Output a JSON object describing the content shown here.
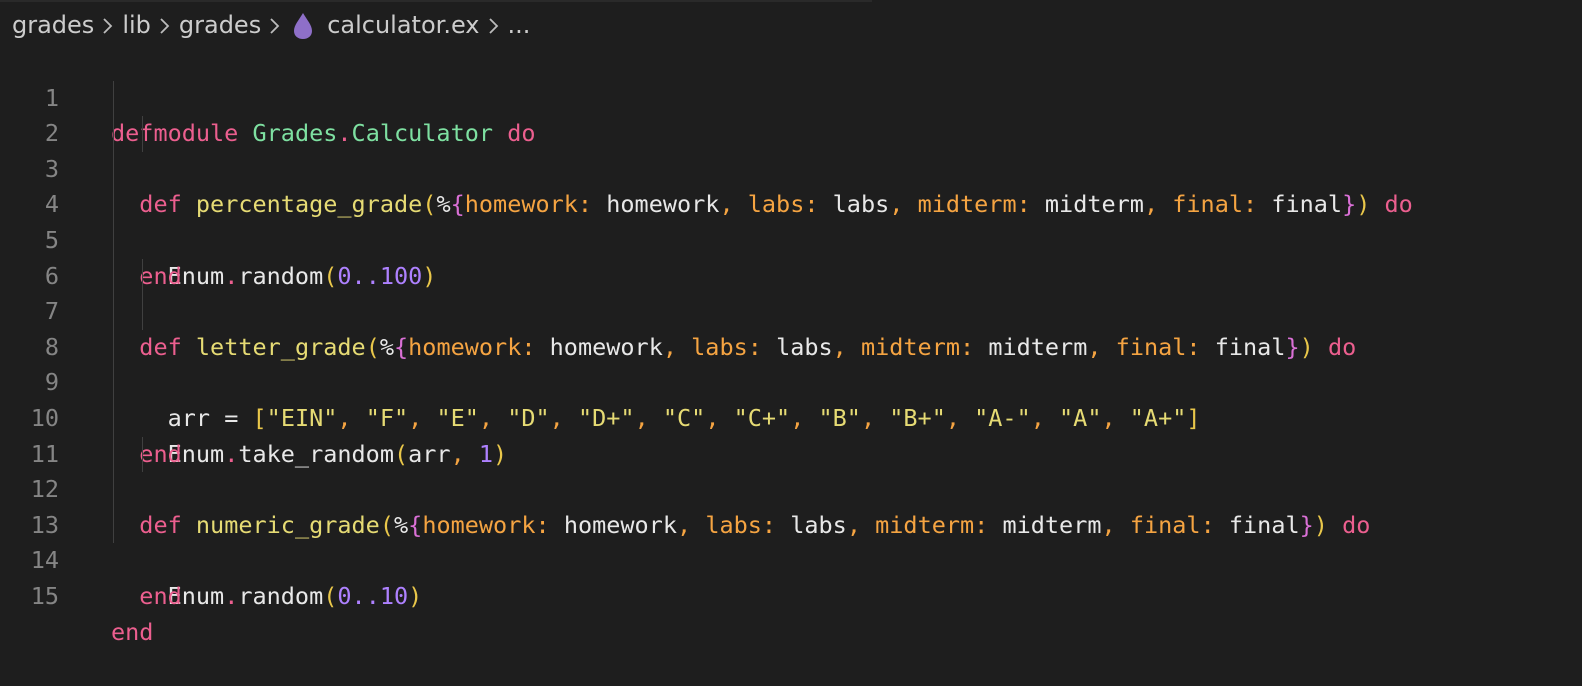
{
  "breadcrumb": {
    "items": [
      "grades",
      "lib",
      "grades",
      "calculator.ex",
      "..."
    ],
    "file_icon": "elixir-drop-icon",
    "file_icon_color": "#8e6fc8"
  },
  "editor": {
    "lines": [
      {
        "n": "1"
      },
      {
        "n": "2"
      },
      {
        "n": "3"
      },
      {
        "n": "4"
      },
      {
        "n": "5"
      },
      {
        "n": "6"
      },
      {
        "n": "7"
      },
      {
        "n": "8"
      },
      {
        "n": "9"
      },
      {
        "n": "10"
      },
      {
        "n": "11"
      },
      {
        "n": "12"
      },
      {
        "n": "13"
      },
      {
        "n": "14"
      },
      {
        "n": "15"
      }
    ],
    "code": {
      "l1": [
        "defmodule",
        " ",
        "Grades",
        ".",
        "Calculator",
        " ",
        "do"
      ],
      "l2": [
        "def",
        " ",
        "percentage_grade",
        "(",
        "%",
        "{",
        "homework:",
        " ",
        "homework",
        ",",
        " ",
        "labs:",
        " ",
        "labs",
        ",",
        " ",
        "midterm:",
        " ",
        "midterm",
        ",",
        " ",
        "final:",
        " ",
        "final",
        "}",
        ")",
        " ",
        "do"
      ],
      "l3": [
        "Enum",
        ".",
        "random",
        "(",
        "0",
        "..",
        "100",
        ")"
      ],
      "l4": [
        "end"
      ],
      "l6": [
        "def",
        " ",
        "letter_grade",
        "(",
        "%",
        "{",
        "homework:",
        " ",
        "homework",
        ",",
        " ",
        "labs:",
        " ",
        "labs",
        ",",
        " ",
        "midterm:",
        " ",
        "midterm",
        ",",
        " ",
        "final:",
        " ",
        "final",
        "}",
        ")",
        " ",
        "do"
      ],
      "l7": [
        "arr",
        " ",
        "=",
        " ",
        "[",
        "\"EIN\"",
        ", ",
        "\"F\"",
        ", ",
        "\"E\"",
        ", ",
        "\"D\"",
        ", ",
        "\"D+\"",
        ", ",
        "\"C\"",
        ", ",
        "\"C+\"",
        ", ",
        "\"B\"",
        ", ",
        "\"B+\"",
        ", ",
        "\"A-\"",
        ", ",
        "\"A\"",
        ", ",
        "\"A+\"",
        "]"
      ],
      "l8": [
        "Enum",
        ".",
        "take_random",
        "(",
        "arr",
        ", ",
        "1",
        ")"
      ],
      "l9": [
        "end"
      ],
      "l11": [
        "def",
        " ",
        "numeric_grade",
        "(",
        "%",
        "{",
        "homework:",
        " ",
        "homework",
        ",",
        " ",
        "labs:",
        " ",
        "labs",
        ",",
        " ",
        "midterm:",
        " ",
        "midterm",
        ",",
        " ",
        "final:",
        " ",
        "final",
        "}",
        ")",
        " ",
        "do"
      ],
      "l12": [
        "Enum",
        ".",
        "random",
        "(",
        "0",
        "..",
        "10",
        ")"
      ],
      "l13": [
        "end"
      ],
      "l15": [
        "end"
      ]
    }
  },
  "colors": {
    "background": "#1e1e1e",
    "keyword": "#ec5f8f",
    "module": "#7ee0a1",
    "function": "#e6db74",
    "map_key": "#f5a442",
    "number": "#ae81ff",
    "line_number": "#858585"
  }
}
